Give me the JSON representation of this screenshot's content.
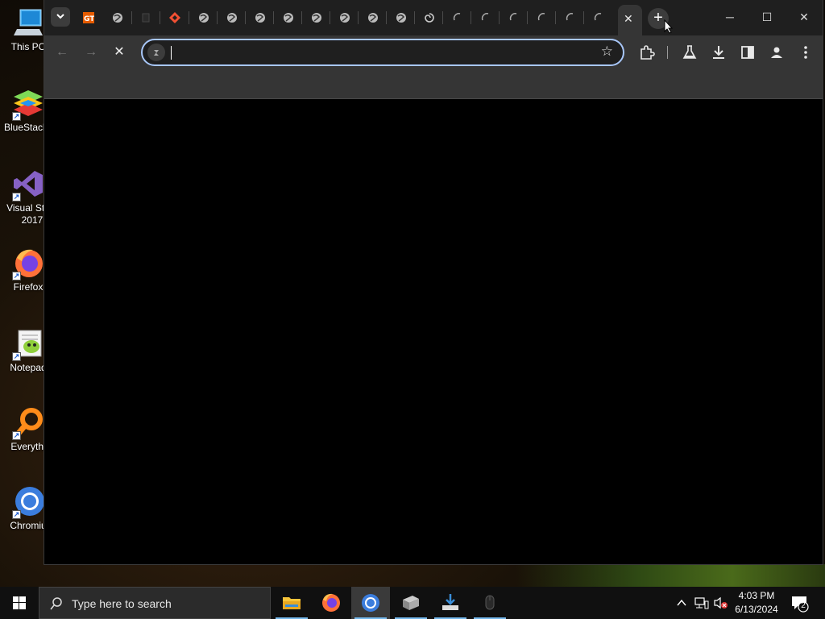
{
  "desktop": {
    "icons": [
      {
        "label": "This PC"
      },
      {
        "label": "BlueStacks"
      },
      {
        "label": "Visual Stu",
        "label2": "2017"
      },
      {
        "label": "Firefox"
      },
      {
        "label": "Notepad"
      },
      {
        "label": "Everythi"
      },
      {
        "label": "Chromiu"
      }
    ]
  },
  "browser": {
    "tabs": {
      "favicons": [
        "tab-search",
        "gt-favicon",
        "globe",
        "dark-page",
        "git-diamond",
        "globe",
        "globe",
        "globe",
        "globe",
        "globe",
        "globe",
        "globe",
        "globe",
        "swirl",
        "loading",
        "loading",
        "loading",
        "loading",
        "loading",
        "loading"
      ],
      "active_tab_close": "✕",
      "new_tab": "+"
    },
    "window_controls": {
      "minimize": "─",
      "maximize": "☐",
      "close": "✕"
    },
    "toolbar": {
      "back": "←",
      "forward": "→",
      "stop": "✕",
      "address_value": "",
      "star": "☆"
    }
  },
  "taskbar": {
    "search_placeholder": "Type here to search",
    "time": "4:03 PM",
    "date": "6/13/2024",
    "notifications_count": "2",
    "apps": [
      "file-explorer",
      "firefox",
      "chromium",
      "package-app",
      "download-app",
      "mouse-app"
    ]
  },
  "colors": {
    "accent": "#a8c7fa",
    "tabstrip": "#1f1f1f",
    "toolbar": "#353535",
    "taskbar": "#101010"
  }
}
